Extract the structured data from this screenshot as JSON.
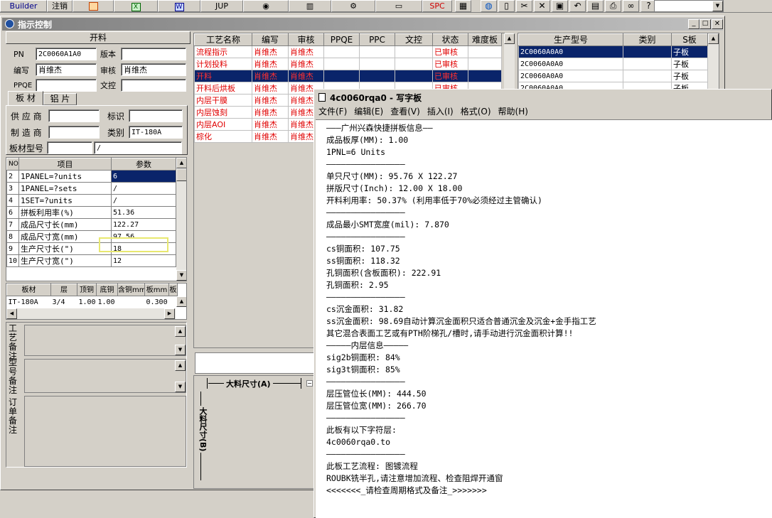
{
  "toolbar": {
    "builder_label": "Builder",
    "logout_label": "注销",
    "jup_label": "JUP",
    "spc_label": "SPC"
  },
  "main_window": {
    "title": "指示控制"
  },
  "kailiao": {
    "header": "开料",
    "pn_label": "PN",
    "pn_value": "2C0060A1A0",
    "version_label": "版本",
    "version_value": "",
    "writer_label": "编写",
    "writer_value": "肖维杰",
    "auditor_label": "审核",
    "auditor_value": "肖维杰",
    "ppqe_label": "PPQE",
    "ppqe_value": "",
    "wenkong_label": "文控",
    "wenkong_value": ""
  },
  "tabs": {
    "board": "板 材",
    "aluminum": "铝 片"
  },
  "material": {
    "supplier_label": "供 应 商",
    "mark_label": "标识",
    "maker_label": "制 造 商",
    "category_label": "类别",
    "category_value": "IT-180A",
    "model_label": "板材型号",
    "model_sep": "/"
  },
  "param_table": {
    "headers": [
      "NO",
      "项目",
      "参数"
    ],
    "rows": [
      {
        "no": "2",
        "item": "1PANEL=?units",
        "value": "6"
      },
      {
        "no": "3",
        "item": "1PANEL=?sets",
        "value": "/"
      },
      {
        "no": "4",
        "item": "1SET=?units",
        "value": "/"
      },
      {
        "no": "6",
        "item": "拼板利用率(%)",
        "value": "51.36"
      },
      {
        "no": "7",
        "item": "成品尺寸长(mm)",
        "value": "122.27"
      },
      {
        "no": "8",
        "item": "成品尺寸宽(mm)",
        "value": "97.56"
      },
      {
        "no": "9",
        "item": "生产尺寸长(\")",
        "value": "18"
      },
      {
        "no": "10",
        "item": "生产尺寸宽(\")",
        "value": "12"
      }
    ]
  },
  "board_table": {
    "headers": [
      "板材",
      "层",
      "顶铜",
      "底铜",
      "含铜mm",
      "板mm",
      "板"
    ],
    "rows": [
      {
        "material": "IT-180A",
        "layer": "3/4",
        "top": "1.00",
        "bottom": "1.00",
        "cu": "",
        "board": "0.300",
        "extra": ""
      }
    ]
  },
  "remarks": {
    "process": "工艺备注",
    "model": "型号备注",
    "order": "订单备注"
  },
  "process_table": {
    "headers": [
      "工艺名称",
      "编写",
      "审核",
      "PPQE",
      "PPC",
      "文控",
      "状态",
      "难度板"
    ],
    "rows": [
      {
        "name": "流程指示",
        "writer": "肖维杰",
        "auditor": "肖维杰",
        "ppqe": "",
        "ppc": "",
        "wk": "",
        "status": "已审核",
        "diff": ""
      },
      {
        "name": "计划投料",
        "writer": "肖维杰",
        "auditor": "肖维杰",
        "ppqe": "",
        "ppc": "",
        "wk": "",
        "status": "已审核",
        "diff": ""
      },
      {
        "name": "开料",
        "writer": "肖维杰",
        "auditor": "肖维杰",
        "ppqe": "",
        "ppc": "",
        "wk": "",
        "status": "已审核",
        "diff": ""
      },
      {
        "name": "开料后烘板",
        "writer": "肖维杰",
        "auditor": "肖维杰",
        "ppqe": "",
        "ppc": "",
        "wk": "",
        "status": "已审核",
        "diff": ""
      },
      {
        "name": "内层干膜",
        "writer": "肖维杰",
        "auditor": "肖维杰",
        "ppqe": "",
        "ppc": "",
        "wk": "",
        "status": "",
        "diff": ""
      },
      {
        "name": "内层蚀刻",
        "writer": "肖维杰",
        "auditor": "肖维杰",
        "ppqe": "",
        "ppc": "",
        "wk": "",
        "status": "",
        "diff": ""
      },
      {
        "name": "内层AOI",
        "writer": "肖维杰",
        "auditor": "肖维杰",
        "ppqe": "",
        "ppc": "",
        "wk": "",
        "status": "",
        "diff": ""
      },
      {
        "name": "棕化",
        "writer": "肖维杰",
        "auditor": "肖维杰",
        "ppqe": "",
        "ppc": "",
        "wk": "",
        "status": "",
        "diff": ""
      }
    ]
  },
  "model_table": {
    "headers": [
      "生产型号",
      "类别",
      "S板"
    ],
    "rows": [
      {
        "model": "2C0060A0A0",
        "type": "",
        "board": "子板"
      },
      {
        "model": "2C0060A0A0",
        "type": "",
        "board": "子板"
      },
      {
        "model": "2C0060A0A0",
        "type": "",
        "board": "子板"
      },
      {
        "model": "2C0060A0A0",
        "type": "",
        "board": "子板"
      }
    ]
  },
  "diagram": {
    "width_label": "大料尺寸(A)",
    "height_label": "大料尺寸(B)"
  },
  "wordpad": {
    "title": "4c0060rqa0 - 写字板",
    "menu": [
      "文件(F)",
      "编辑(E)",
      "查看(V)",
      "插入(I)",
      "格式(O)",
      "帮助(H)"
    ],
    "lines": [
      "———广州兴森快捷拼板信息——",
      "成品板厚(MM): 1.00",
      "1PNL=6 Units",
      "————————————————",
      "单只尺寸(MM): 95.76 X 122.27",
      "拼版尺寸(Inch): 12.00 X 18.00",
      "开料利用率: 50.37% (利用率低于70%必须经过主管确认)",
      "————————————————",
      "成品最小SMT宽度(mil): 7.870",
      "————————————————",
      "cs铜面积: 107.75",
      "ss铜面积: 118.32",
      "孔铜面积(含板面积): 222.91",
      "孔铜面积: 2.95",
      "————————————————",
      "cs沉金面积: 31.82",
      "ss沉金面积: 98.69自动计算沉金面积只适合普通沉金及沉金+金手指工艺",
      "其它混合表面工艺或有PTH阶梯孔/槽时,请手动进行沉金面积计算!!",
      "—————内层信息—————",
      "sig2b铜面积: 84%",
      "sig3t铜面积: 85%",
      "————————————————",
      "层压管位长(MM): 444.50",
      "层压管位宽(MM): 266.70",
      "————————————————",
      "此板有以下字符层:",
      "4c0060rqa0.to",
      "————————————————",
      "此板工艺流程: 图镀流程",
      "ROUBK铣半孔,请注意增加流程、检查阻焊开通窗",
      "<<<<<<<_请检查周期格式及备注_>>>>>>>"
    ]
  }
}
